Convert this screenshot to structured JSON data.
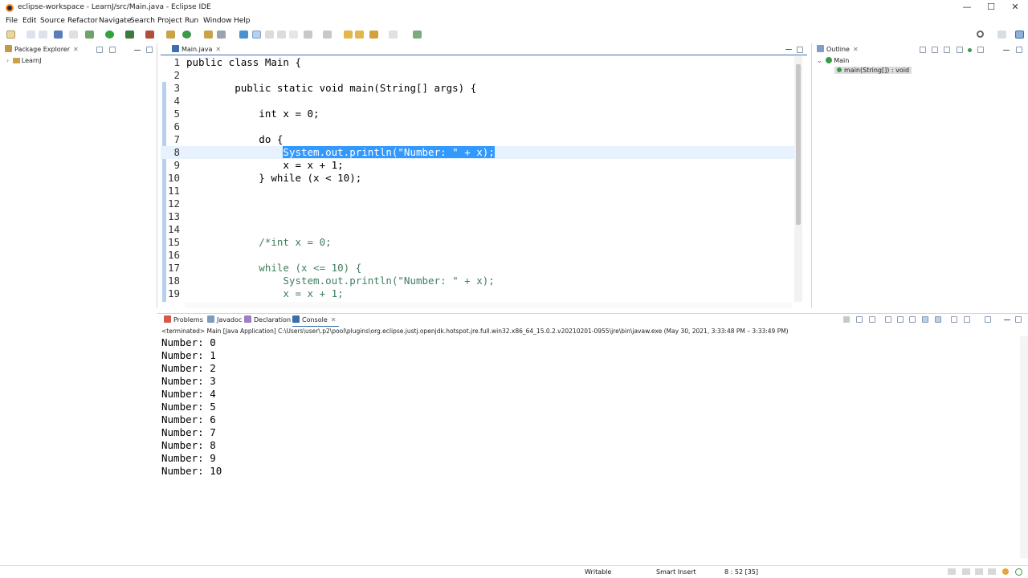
{
  "window": {
    "title": "eclipse-workspace - LearnJ/src/Main.java - Eclipse IDE"
  },
  "menu": [
    "File",
    "Edit",
    "Source",
    "Refactor",
    "Navigate",
    "Search",
    "Project",
    "Run",
    "Window",
    "Help"
  ],
  "package_explorer": {
    "tab_label": "Package Explorer",
    "project": "LearnJ"
  },
  "editor": {
    "tab_label": "Main.java",
    "lines": [
      {
        "n": "1",
        "text": "public class Main {"
      },
      {
        "n": "2",
        "text": ""
      },
      {
        "n": "3",
        "text": "        public static void main(String[] args) {"
      },
      {
        "n": "4",
        "text": ""
      },
      {
        "n": "5",
        "text": "            int x = 0;"
      },
      {
        "n": "6",
        "text": ""
      },
      {
        "n": "7",
        "text": "            do {"
      },
      {
        "n": "8",
        "text": "System.out.println(\"Number: \" + x);"
      },
      {
        "n": "9",
        "text": "                x = x + 1;"
      },
      {
        "n": "10",
        "text": "            } while (x < 10);"
      },
      {
        "n": "11",
        "text": ""
      },
      {
        "n": "12",
        "text": ""
      },
      {
        "n": "13",
        "text": ""
      },
      {
        "n": "14",
        "text": ""
      },
      {
        "n": "15",
        "text": "            /*int x = 0;"
      },
      {
        "n": "16",
        "text": ""
      },
      {
        "n": "17",
        "text": "            while (x <= 10) {"
      },
      {
        "n": "18",
        "text": "                System.out.println(\"Number: \" + x);"
      },
      {
        "n": "19",
        "text": "                x = x + 1;"
      }
    ],
    "line8_indent": "                "
  },
  "outline": {
    "tab_label": "Outline",
    "class_name": "Main",
    "method": "main(String[]) : void"
  },
  "bottom_tabs": [
    "Problems",
    "Javadoc",
    "Declaration",
    "Console"
  ],
  "console": {
    "header": "<terminated> Main [Java Application] C:\\Users\\user\\.p2\\pool\\plugins\\org.eclipse.justj.openjdk.hotspot.jre.full.win32.x86_64_15.0.2.v20210201-0955\\jre\\bin\\javaw.exe  (May 30, 2021, 3:33:48 PM – 3:33:49 PM)",
    "output": [
      "Number: 0",
      "Number: 1",
      "Number: 2",
      "Number: 3",
      "Number: 4",
      "Number: 5",
      "Number: 6",
      "Number: 7",
      "Number: 8",
      "Number: 9",
      "Number: 10"
    ]
  },
  "status": {
    "writable": "Writable",
    "insert_mode": "Smart Insert",
    "position": "8 : 52 [35]"
  }
}
